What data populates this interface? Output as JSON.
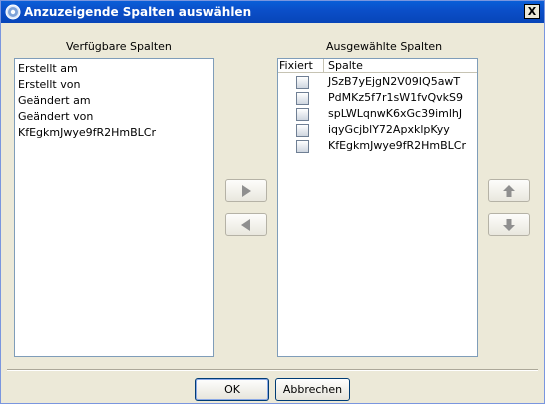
{
  "window": {
    "title": "Anzuzeigende Spalten auswählen",
    "close_label": "X"
  },
  "available": {
    "heading": "Verfügbare Spalten",
    "items": [
      "Erstellt am",
      "Erstellt von",
      "Geändert am",
      "Geändert von",
      "KfEgkmJwye9fR2HmBLCr"
    ]
  },
  "selected": {
    "heading": "Ausgewählte Spalten",
    "columns": {
      "fixed": "Fixiert",
      "column": "Spalte"
    },
    "rows": [
      {
        "name": "JSzB7yEjgN2V09IQ5awT",
        "fixed": false
      },
      {
        "name": "PdMKz5f7r1sW1fvQvkS9",
        "fixed": false
      },
      {
        "name": "spLWLqnwK6xGc39imlhJ",
        "fixed": false
      },
      {
        "name": "iqyGcjblY72ApxklpKyy",
        "fixed": false
      },
      {
        "name": "KfEgkmJwye9fR2HmBLCr",
        "fixed": false
      }
    ]
  },
  "buttons": {
    "ok": "OK",
    "cancel": "Abbrechen"
  },
  "icons": {
    "title": "window-globe-icon",
    "add": "arrow-right-icon",
    "remove": "arrow-left-icon",
    "up": "arrow-up-icon",
    "down": "arrow-down-icon"
  },
  "colors": {
    "titlebar": "#0a5fd8",
    "dialog_bg": "#ece9d8",
    "list_border": "#7f9db9"
  }
}
